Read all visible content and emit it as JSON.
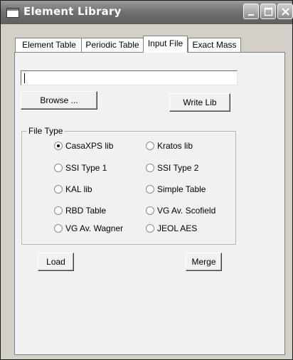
{
  "window": {
    "title": "Element Library"
  },
  "tabs": [
    {
      "label": "Element Table"
    },
    {
      "label": "Periodic Table"
    },
    {
      "label": "Input File",
      "active": true
    },
    {
      "label": "Exact Mass"
    }
  ],
  "file_input": {
    "value": ""
  },
  "buttons": {
    "browse": "Browse ...",
    "write_lib": "Write Lib",
    "load": "Load",
    "merge": "Merge"
  },
  "file_type": {
    "label": "File Type",
    "selected": "CasaXPS lib",
    "options": [
      "CasaXPS lib",
      "Kratos lib",
      "SSI Type 1",
      "SSI Type 2",
      "KAL lib",
      "Simple Table",
      "RBD Table",
      "VG Av. Scofield",
      "VG Av. Wagner",
      "JEOL AES"
    ]
  },
  "icons": {
    "app": "window-icon",
    "minimize": "minimize-icon",
    "maximize": "maximize-icon",
    "close": "close-icon"
  }
}
